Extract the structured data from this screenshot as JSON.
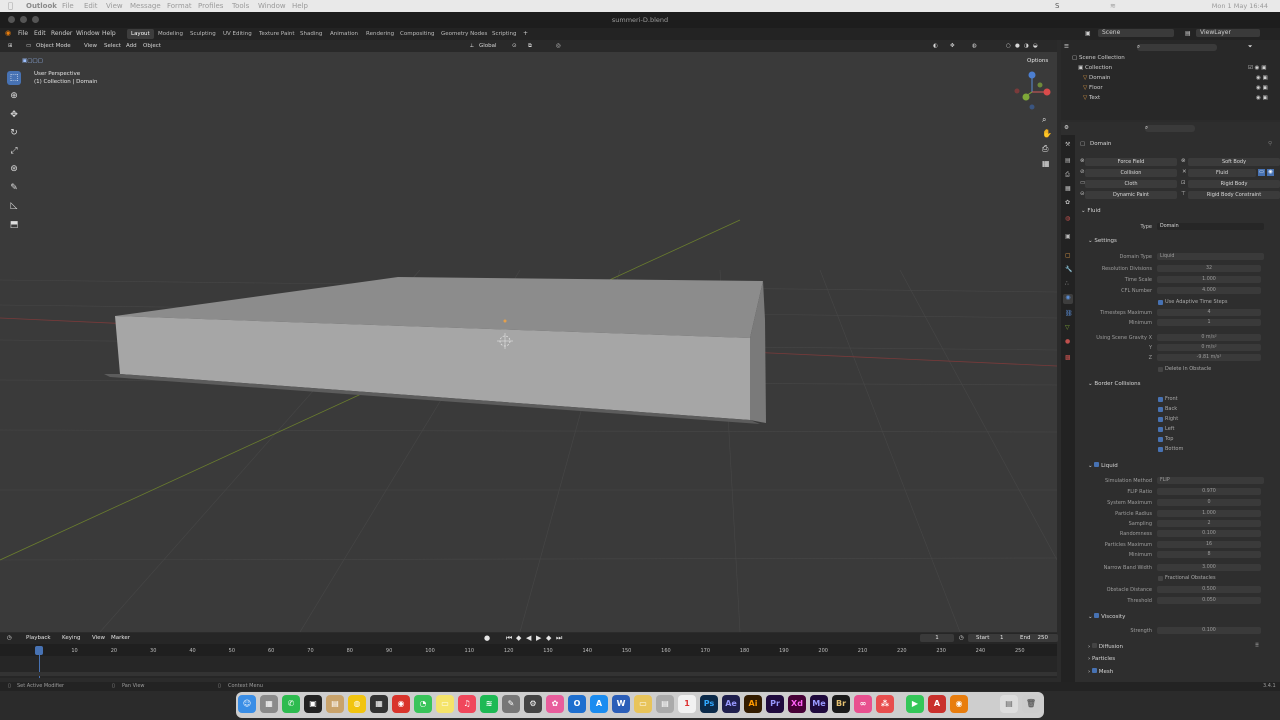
{
  "mac_menu": {
    "app": "Outlook",
    "items": [
      "File",
      "Edit",
      "View",
      "Message",
      "Format",
      "Profiles",
      "Tools",
      "Window",
      "Help"
    ],
    "clock": "Mon 1 May  16:44"
  },
  "window_title": "summeri-D.blend",
  "blender_menu": [
    "File",
    "Edit",
    "Render",
    "Window",
    "Help"
  ],
  "workspaces": [
    "Layout",
    "Modeling",
    "Sculpting",
    "UV Editing",
    "Texture Paint",
    "Shading",
    "Animation",
    "Rendering",
    "Compositing",
    "Geometry Nodes",
    "Scripting"
  ],
  "active_workspace": "Layout",
  "scene_field": "Scene",
  "viewlayer_field": "ViewLayer",
  "viewport_header": {
    "mode": "Object Mode",
    "menus": [
      "View",
      "Select",
      "Add",
      "Object"
    ],
    "orientation": "Global",
    "options": "Options"
  },
  "viewport_overlay": {
    "perspective": "User Perspective",
    "collection": "(1) Collection | Domain"
  },
  "outliner": {
    "root": "Scene Collection",
    "collection": "Collection",
    "objects": [
      "Domain",
      "Floor",
      "Text"
    ]
  },
  "properties": {
    "object_name": "Domain",
    "physics_buttons_left": [
      "Force Field",
      "Collision",
      "Cloth",
      "Dynamic Paint"
    ],
    "physics_buttons_right": [
      "Soft Body",
      "Fluid",
      "Rigid Body",
      "Rigid Body Constraint"
    ],
    "fluid_header": "Fluid",
    "type_label": "Type",
    "type_value": "Domain",
    "settings_header": "Settings",
    "settings_rows": [
      {
        "label": "Domain Type",
        "value": "Liquid"
      },
      {
        "label": "Resolution Divisions",
        "value": "32"
      },
      {
        "label": "Time Scale",
        "value": "1.000"
      },
      {
        "label": "CFL Number",
        "value": "4.000"
      }
    ],
    "adaptive_label": "Use Adaptive Time Steps",
    "timestep_rows": [
      {
        "label": "Timesteps Maximum",
        "value": "4"
      },
      {
        "label": "Minimum",
        "value": "1"
      }
    ],
    "gravity_rows": [
      {
        "label": "Using Scene Gravity X",
        "value": "0 m/s²"
      },
      {
        "label": "Y",
        "value": "0 m/s²"
      },
      {
        "label": "Z",
        "value": "-9.81 m/s²"
      }
    ],
    "delete_obstacle": "Delete In Obstacle",
    "border_header": "Border Collisions",
    "border_items": [
      "Front",
      "Back",
      "Right",
      "Left",
      "Top",
      "Bottom"
    ],
    "liquid_header": "Liquid",
    "liquid_rows": [
      {
        "label": "Simulation Method",
        "value": "FLIP"
      },
      {
        "label": "FLIP Ratio",
        "value": "0.970"
      },
      {
        "label": "System Maximum",
        "value": "0"
      },
      {
        "label": "Particle Radius",
        "value": "1.000"
      },
      {
        "label": "Sampling",
        "value": "2"
      },
      {
        "label": "Randomness",
        "value": "0.100"
      },
      {
        "label": "Particles Maximum",
        "value": "16"
      },
      {
        "label": "Minimum",
        "value": "8"
      },
      {
        "label": "Narrow Band Width",
        "value": "3.000"
      }
    ],
    "fractional": "Fractional Obstacles",
    "obstacle_rows": [
      {
        "label": "Obstacle Distance",
        "value": "0.500"
      },
      {
        "label": "Threshold",
        "value": "0.050"
      }
    ],
    "viscosity_header": "Viscosity",
    "strength_label": "Strength",
    "strength_value": "0.100",
    "diffusion": "Diffusion",
    "particles": "Particles",
    "mesh": "Mesh"
  },
  "timeline": {
    "menus": [
      "Playback",
      "Keying",
      "View",
      "Marker"
    ],
    "current_frame": "1",
    "start_label": "Start",
    "start_value": "1",
    "end_label": "End",
    "end_value": "250",
    "ticks": [
      "1",
      "10",
      "20",
      "30",
      "40",
      "50",
      "60",
      "70",
      "80",
      "90",
      "100",
      "110",
      "120",
      "130",
      "140",
      "150",
      "160",
      "170",
      "180",
      "190",
      "200",
      "210",
      "220",
      "230",
      "240",
      "250"
    ]
  },
  "status": {
    "left": "Set Active Modifier",
    "middle": "Pan View",
    "right": "Context Menu",
    "version": "3.4.1"
  },
  "colors": {
    "accent": "#4772b3",
    "viewport_bg": "#3a3a3a",
    "panel_bg": "#2e2e2e"
  }
}
